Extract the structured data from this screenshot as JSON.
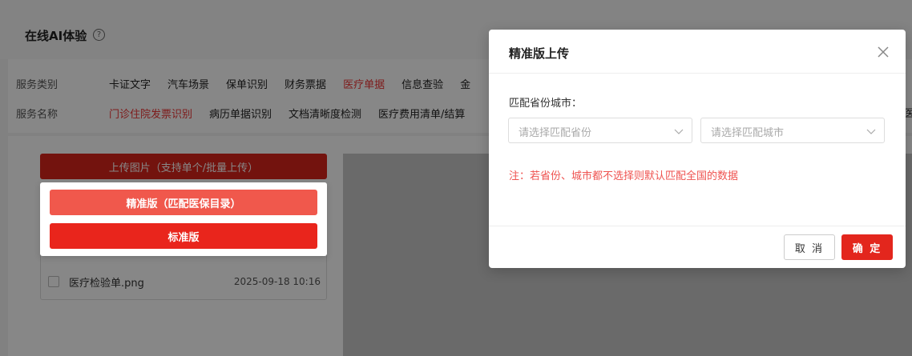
{
  "page": {
    "title": "在线AI体验",
    "help_icon": "question-circle-icon",
    "help_glyph": "?"
  },
  "filters": {
    "category_label": "服务类别",
    "categories": [
      {
        "label": "卡证文字",
        "active": false
      },
      {
        "label": "汽车场景",
        "active": false
      },
      {
        "label": "保单识别",
        "active": false
      },
      {
        "label": "财务票据",
        "active": false
      },
      {
        "label": "医疗单据",
        "active": true
      },
      {
        "label": "信息查验",
        "active": false
      },
      {
        "label": "金",
        "active": false
      }
    ],
    "service_label": "服务名称",
    "services": [
      {
        "label": "门诊住院发票识别",
        "active": true
      },
      {
        "label": "病历单据识别",
        "active": false
      },
      {
        "label": "文档清晰度检测",
        "active": false
      },
      {
        "label": "医疗费用清单/结算",
        "active": false
      }
    ],
    "services_overflow": "医"
  },
  "upload": {
    "button_label": "上传图片（支持单个/批量上传）",
    "menu": {
      "precise_label": "精准版（匹配医保目录）",
      "standard_label": "标准版"
    },
    "files": [
      {
        "name": "医疗检验单.png",
        "time": "2025-09-18 10:16"
      }
    ]
  },
  "modal": {
    "title": "精准版上传",
    "close_icon": "close-icon",
    "field_label": "匹配省份城市：",
    "province_placeholder": "请选择匹配省份",
    "city_placeholder": "请选择匹配城市",
    "note": "注：若省份、城市都不选择则默认匹配全国的数据",
    "cancel_label": "取 消",
    "ok_label": "确 定"
  },
  "colors": {
    "accent": "#e3261d",
    "accent_light": "#f0584c",
    "active_text": "#e33",
    "note_text": "#ef5350",
    "mask": "rgba(0,0,0,0.47)"
  }
}
